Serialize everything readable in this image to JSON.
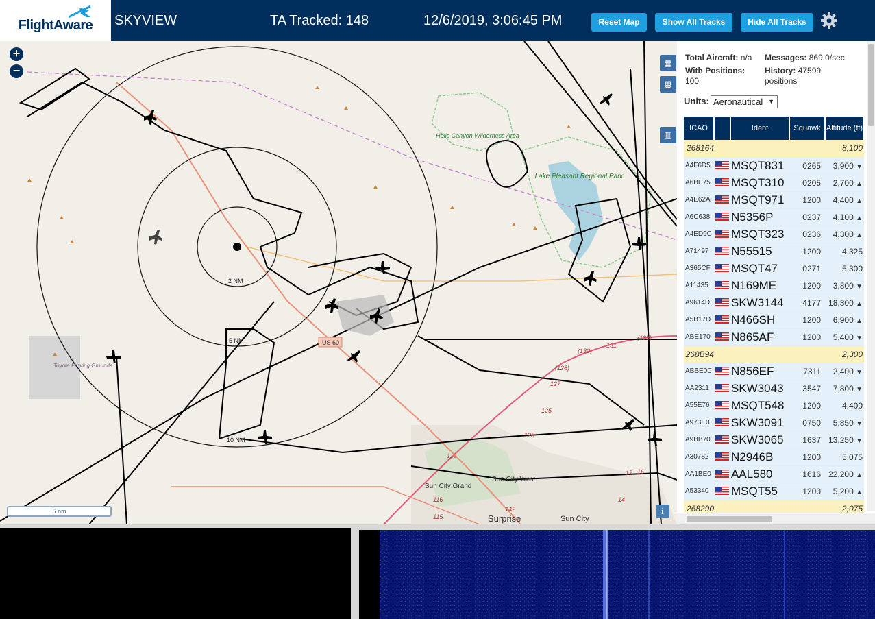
{
  "header": {
    "logo_text": "FlightAware",
    "site_name": "SKYVIEW",
    "tracked_label": "TA Tracked: 148",
    "datetime": "12/6/2019, 3:06:45 PM",
    "reset_map": "Reset Map",
    "show_all_tracks": "Show All Tracks",
    "hide_all_tracks": "Hide All Tracks",
    "settings_icon": "gear-icon"
  },
  "map": {
    "zoom_in": "+",
    "zoom_out": "−",
    "range_labels": [
      "2 NM",
      "5 NM",
      "10 NM"
    ],
    "places": [
      "Hells Canyon Wilderness Area",
      "Lake Pleasant Regional Park",
      "Toyota Proving Grounds",
      "Sun City Grand",
      "Sun City West",
      "Surprise",
      "Sun City"
    ],
    "road_labels": [
      "US 60",
      "(135)",
      "(130)",
      "131",
      "(128)",
      "127",
      "125",
      "123",
      "119",
      "116",
      "115",
      "142",
      "14",
      "17",
      "16"
    ],
    "scale": "5 nm",
    "info": "i",
    "layer_icons": [
      "map-layers-icon",
      "grid-icon",
      "columns-icon"
    ]
  },
  "panel": {
    "total_aircraft_label": "Total Aircraft:",
    "total_aircraft_value": "n/a",
    "messages_label": "Messages:",
    "messages_value": "869.0/sec",
    "with_positions_label": "With Positions:",
    "with_positions_value": "100",
    "history_label": "History:",
    "history_value": "47599 positions",
    "units_label": "Units:",
    "units_value": "Aeronautical",
    "columns": [
      "ICAO",
      "",
      "Ident",
      "Squawk",
      "Altitude (ft)"
    ],
    "rows": [
      {
        "icao": "268164",
        "flag": false,
        "ident": "",
        "squawk": "",
        "altitude": "8,100",
        "trend": "",
        "highlight": true
      },
      {
        "icao": "A4F6D5",
        "flag": true,
        "ident": "MSQT831",
        "squawk": "0265",
        "altitude": "3,900",
        "trend": "▼",
        "highlight": false
      },
      {
        "icao": "A6BE75",
        "flag": true,
        "ident": "MSQT310",
        "squawk": "0205",
        "altitude": "2,700",
        "trend": "▲",
        "highlight": false
      },
      {
        "icao": "A4E62A",
        "flag": true,
        "ident": "MSQT971",
        "squawk": "1200",
        "altitude": "4,400",
        "trend": "▲",
        "highlight": false
      },
      {
        "icao": "A6C638",
        "flag": true,
        "ident": "N5356P",
        "squawk": "0237",
        "altitude": "4,100",
        "trend": "▲",
        "highlight": false
      },
      {
        "icao": "A4ED9C",
        "flag": true,
        "ident": "MSQT323",
        "squawk": "0236",
        "altitude": "4,300",
        "trend": "▲",
        "highlight": false
      },
      {
        "icao": "A71497",
        "flag": true,
        "ident": "N55515",
        "squawk": "1200",
        "altitude": "4,325",
        "trend": "",
        "highlight": false
      },
      {
        "icao": "A365CF",
        "flag": true,
        "ident": "MSQT47",
        "squawk": "0271",
        "altitude": "5,300",
        "trend": "",
        "highlight": false
      },
      {
        "icao": "A11435",
        "flag": true,
        "ident": "N169ME",
        "squawk": "1200",
        "altitude": "3,800",
        "trend": "▼",
        "highlight": false
      },
      {
        "icao": "A9614D",
        "flag": true,
        "ident": "SKW3144",
        "squawk": "4177",
        "altitude": "18,300",
        "trend": "▲",
        "highlight": false
      },
      {
        "icao": "A5B17D",
        "flag": true,
        "ident": "N466SH",
        "squawk": "1200",
        "altitude": "6,900",
        "trend": "▲",
        "highlight": false
      },
      {
        "icao": "ABE170",
        "flag": true,
        "ident": "N865AF",
        "squawk": "1200",
        "altitude": "5,400",
        "trend": "▼",
        "highlight": false
      },
      {
        "icao": "268B94",
        "flag": false,
        "ident": "",
        "squawk": "",
        "altitude": "2,300",
        "trend": "",
        "highlight": true
      },
      {
        "icao": "ABBE0C",
        "flag": true,
        "ident": "N856EF",
        "squawk": "7311",
        "altitude": "2,400",
        "trend": "▼",
        "highlight": false
      },
      {
        "icao": "AA2311",
        "flag": true,
        "ident": "SKW3043",
        "squawk": "3547",
        "altitude": "7,800",
        "trend": "▼",
        "highlight": false
      },
      {
        "icao": "A55E76",
        "flag": true,
        "ident": "MSQT548",
        "squawk": "1200",
        "altitude": "4,400",
        "trend": "",
        "highlight": false
      },
      {
        "icao": "A973E0",
        "flag": true,
        "ident": "SKW3091",
        "squawk": "0750",
        "altitude": "5,850",
        "trend": "▼",
        "highlight": false
      },
      {
        "icao": "A9BB70",
        "flag": true,
        "ident": "SKW3065",
        "squawk": "1637",
        "altitude": "13,250",
        "trend": "▼",
        "highlight": false
      },
      {
        "icao": "A30782",
        "flag": true,
        "ident": "N2946B",
        "squawk": "1200",
        "altitude": "5,075",
        "trend": "",
        "highlight": false
      },
      {
        "icao": "AA1BE0",
        "flag": true,
        "ident": "AAL580",
        "squawk": "1616",
        "altitude": "22,200",
        "trend": "▲",
        "highlight": false
      },
      {
        "icao": "A53340",
        "flag": true,
        "ident": "MSQT55",
        "squawk": "1200",
        "altitude": "5,200",
        "trend": "▲",
        "highlight": false
      },
      {
        "icao": "268290",
        "flag": false,
        "ident": "",
        "squawk": "",
        "altitude": "2,075",
        "trend": "",
        "highlight": true
      }
    ]
  },
  "colors": {
    "header_bg": "#002f5d",
    "button_bg": "#1d9fe0",
    "row_bg": "#e5f1fa",
    "alt_row_bg": "#fbf1bd",
    "spectrum_bg": "#0a1770"
  }
}
